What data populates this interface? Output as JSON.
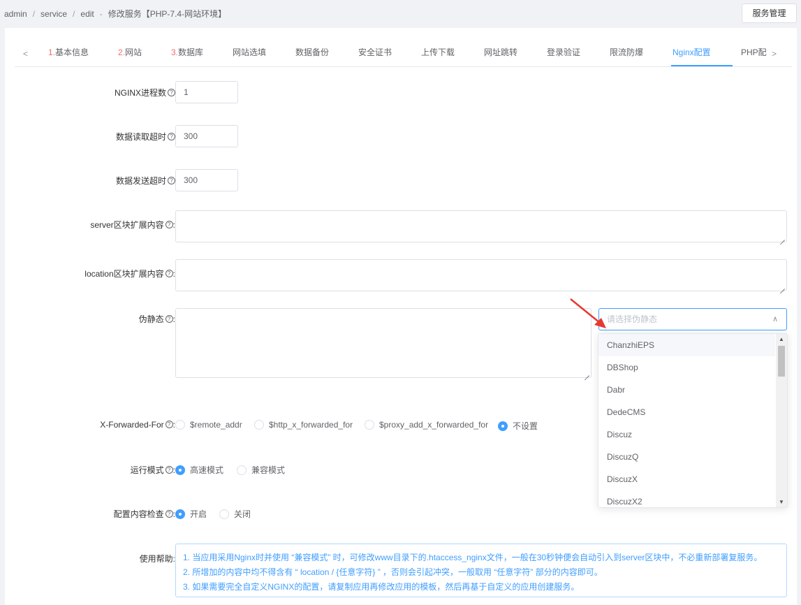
{
  "breadcrumb": [
    "admin",
    "service",
    "edit",
    "修改服务【PHP-7.4-网站环境】"
  ],
  "header_button": "服务管理",
  "tabs": [
    {
      "num": "1.",
      "label": "基本信息"
    },
    {
      "num": "2.",
      "label": "网站"
    },
    {
      "num": "3.",
      "label": "数据库"
    },
    {
      "num": "",
      "label": "网站选填"
    },
    {
      "num": "",
      "label": "数据备份"
    },
    {
      "num": "",
      "label": "安全证书"
    },
    {
      "num": "",
      "label": "上传下载"
    },
    {
      "num": "",
      "label": "网址跳转"
    },
    {
      "num": "",
      "label": "登录验证"
    },
    {
      "num": "",
      "label": "限流防爆"
    },
    {
      "num": "",
      "label": "Nginx配置"
    },
    {
      "num": "",
      "label": "PHP配"
    }
  ],
  "active_tab": "Nginx配置",
  "form": {
    "nginx_workers": {
      "label": "NGINX进程数",
      "value": "1"
    },
    "read_timeout": {
      "label": "数据读取超时",
      "value": "300"
    },
    "send_timeout": {
      "label": "数据发送超时",
      "value": "300"
    },
    "server_ext": {
      "label": "server区块扩展内容",
      "value": ""
    },
    "location_ext": {
      "label": "location区块扩展内容",
      "value": ""
    },
    "rewrite": {
      "label": "伪静态",
      "value": "",
      "select_placeholder": "请选择伪静态"
    },
    "xff": {
      "label": "X-Forwarded-For",
      "options": [
        "$remote_addr",
        "$http_x_forwarded_for",
        "$proxy_add_x_forwarded_for",
        "不设置"
      ],
      "selected": "不设置"
    },
    "run_mode": {
      "label": "运行模式",
      "options": [
        "高速模式",
        "兼容模式"
      ],
      "selected": "高速模式"
    },
    "config_check": {
      "label": "配置内容检查",
      "options": [
        "开启",
        "关闭"
      ],
      "selected": "开启"
    },
    "usage_help": {
      "label": "使用帮助",
      "lines": [
        "1. 当应用采用Nginx时并使用 “兼容模式” 时，可修改www目录下的.htaccess_nginx文件，一般在30秒钟便会自动引入到server区块中，不必重新部署复服务。",
        "2. 所增加的内容中均不得含有 “ location / {任意字符} ” ，否则会引起冲突，一般取用 “任意字符” 部分的内容即可。",
        "3. 如果需要完全自定义NGINX的配置，请复制应用再修改应用的模板，然后再基于自定义的应用创建服务。"
      ]
    }
  },
  "rewrite_options": [
    "ChanzhiEPS",
    "DBShop",
    "Dabr",
    "DedeCMS",
    "Discuz",
    "DiscuzQ",
    "DiscuzX",
    "DiscuzX2"
  ],
  "colors": {
    "accent": "#409eff",
    "tab_number": "#f56c6c",
    "annotation_arrow": "#e8382f"
  }
}
